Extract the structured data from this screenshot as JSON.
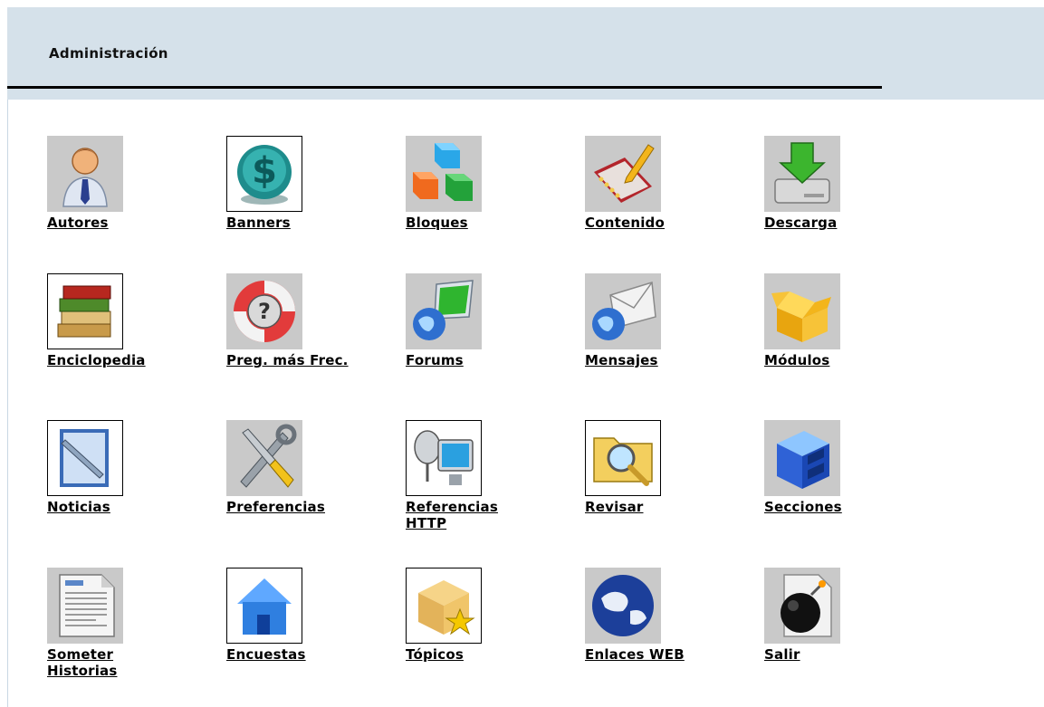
{
  "header": {
    "title": "Administración"
  },
  "items": [
    {
      "label": "Autores",
      "icon": "user-icon"
    },
    {
      "label": "Banners",
      "icon": "dollar-coin-icon"
    },
    {
      "label": "Bloques",
      "icon": "blocks-icon"
    },
    {
      "label": "Contenido",
      "icon": "notebook-pencil-icon"
    },
    {
      "label": "Descarga",
      "icon": "download-drive-icon"
    },
    {
      "label": "Enciclopedia",
      "icon": "books-icon"
    },
    {
      "label": "Preg. más Frec.",
      "icon": "lifebuoy-question-icon"
    },
    {
      "label": "Forums",
      "icon": "globe-monitor-icon"
    },
    {
      "label": "Mensajes",
      "icon": "globe-envelope-icon"
    },
    {
      "label": "Módulos",
      "icon": "open-box-icon"
    },
    {
      "label": "Noticias",
      "icon": "pen-document-icon"
    },
    {
      "label": "Preferencias",
      "icon": "tools-icon"
    },
    {
      "label": "Referencias HTTP",
      "icon": "satellite-monitor-icon"
    },
    {
      "label": "Revisar",
      "icon": "folder-magnifier-icon"
    },
    {
      "label": "Secciones",
      "icon": "cabinet-icon"
    },
    {
      "label": "Someter Historias",
      "icon": "document-page-icon"
    },
    {
      "label": "Encuestas",
      "icon": "house-icon"
    },
    {
      "label": "Tópicos",
      "icon": "box-star-icon"
    },
    {
      "label": "Enlaces WEB",
      "icon": "globe-icon"
    },
    {
      "label": "Salir",
      "icon": "bomb-icon"
    }
  ]
}
